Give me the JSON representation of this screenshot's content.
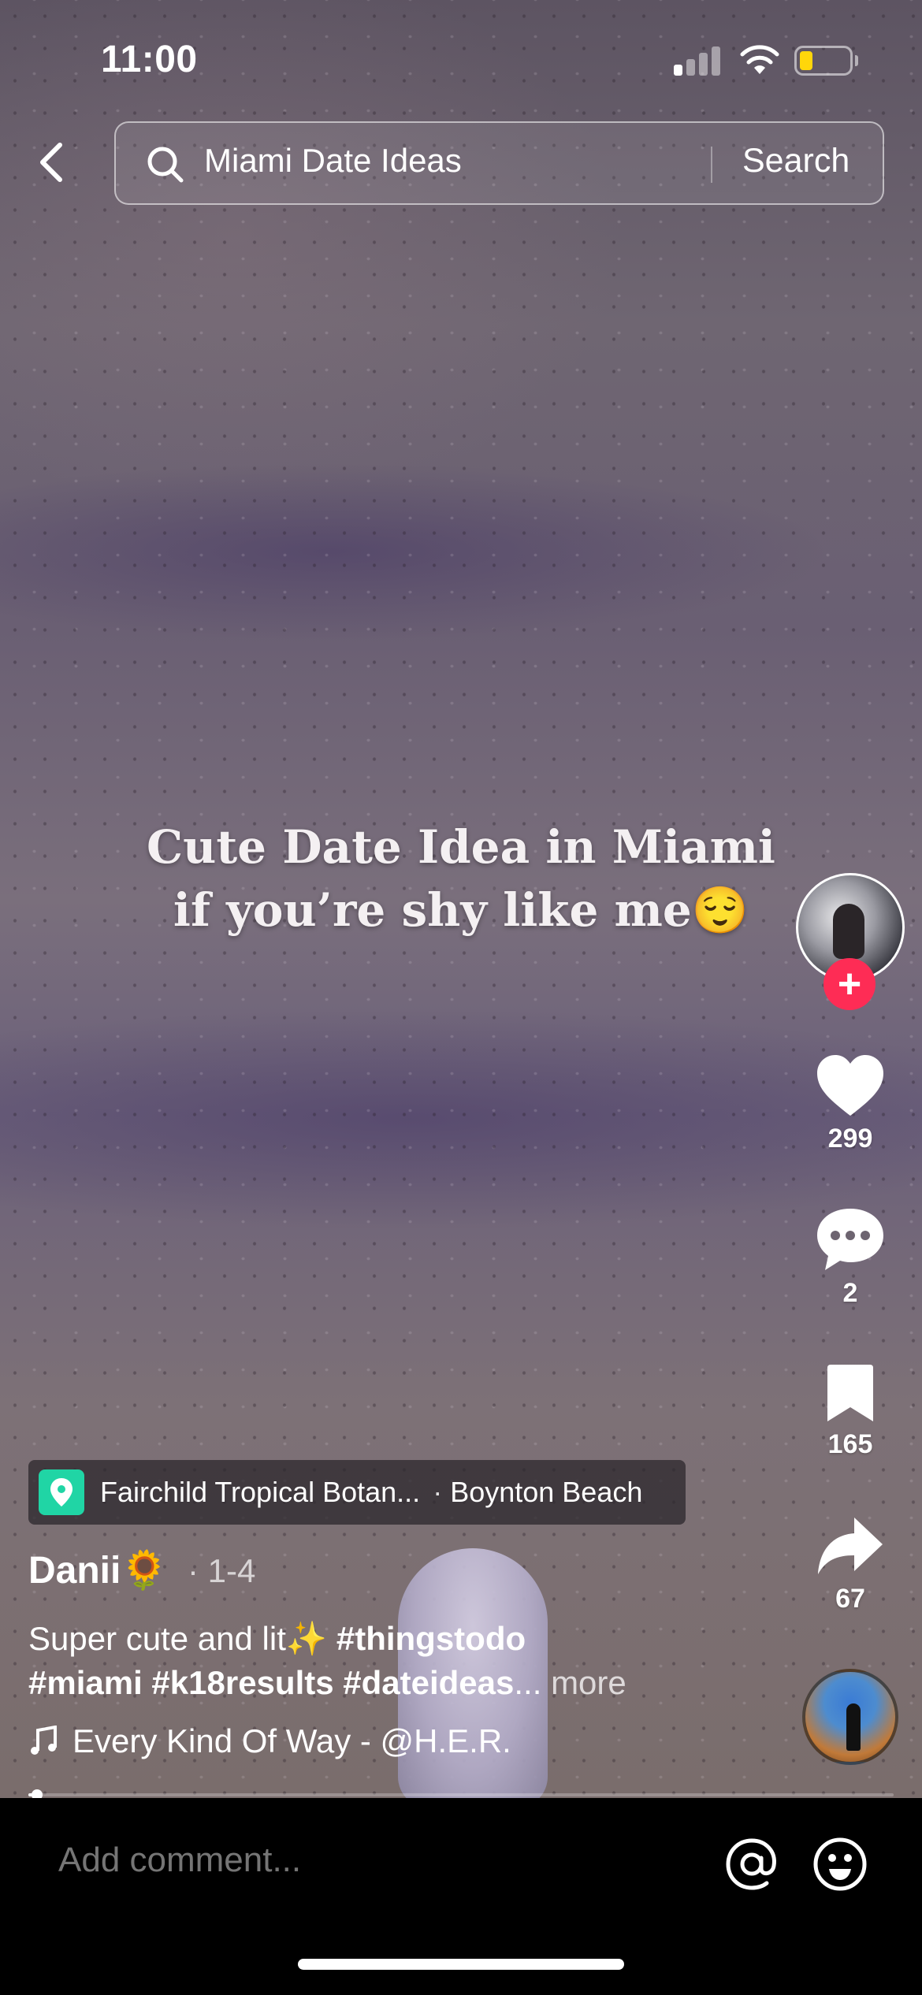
{
  "status_bar": {
    "time": "11:00",
    "signal_bars_active": 1,
    "signal_bars_total": 4,
    "battery_level": 0.2,
    "battery_color": "#ffd60a"
  },
  "header": {
    "back_icon": "chevron-left-icon",
    "search_query": "Miami Date Ideas",
    "search_button": "Search"
  },
  "video": {
    "overlay_line1": "Cute Date Idea in Miami",
    "overlay_line2": "if you’re shy like me😌"
  },
  "actions": {
    "like_count": "299",
    "comment_count": "2",
    "save_count": "165",
    "share_count": "67",
    "follow_label": "+",
    "accent_color": "#fe2c55"
  },
  "location": {
    "name": "Fairchild Tropical Botan...",
    "separator": "·",
    "city": "Boynton Beach",
    "icon_color": "#20d5a5"
  },
  "post": {
    "author": "Danii",
    "author_emoji": "🌻",
    "date": "· 1-4",
    "description_text": "Super cute and lit✨ ",
    "hashtags_line1": "#thingstodo",
    "hashtags_line2": "#miami #k18results #dateideas",
    "ellipsis": "...",
    "more_label": "more",
    "progress": 0.01
  },
  "music": {
    "title": "Every Kind Of Way - @H.E.R."
  },
  "comment_bar": {
    "placeholder": "Add comment...",
    "mention_icon": "at-sign-icon",
    "emoji_icon": "smiley-icon"
  }
}
